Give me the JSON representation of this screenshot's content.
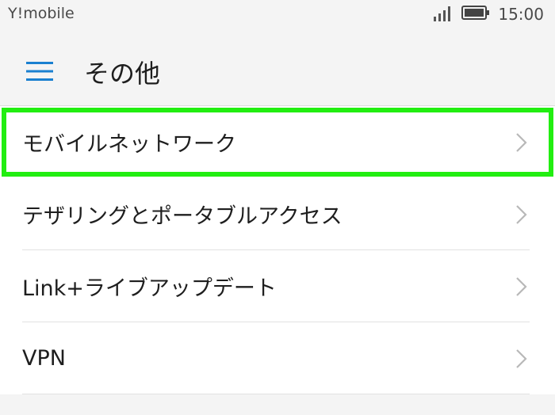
{
  "status_bar": {
    "carrier": "Y!mobile",
    "time": "15:00",
    "signal_icon": "cellular-signal-icon",
    "battery_icon": "battery-icon"
  },
  "header": {
    "title": "その他",
    "menu_icon": "hamburger-menu-icon"
  },
  "settings": {
    "items": [
      {
        "label": "モバイルネットワーク",
        "highlighted": true
      },
      {
        "label": "テザリングとポータブルアクセス"
      },
      {
        "label": "Link+ライブアップデート"
      },
      {
        "label": "VPN"
      }
    ]
  },
  "colors": {
    "accent": "#1a80d0",
    "highlight": "#22ee11",
    "background": "#f4f4f4"
  }
}
